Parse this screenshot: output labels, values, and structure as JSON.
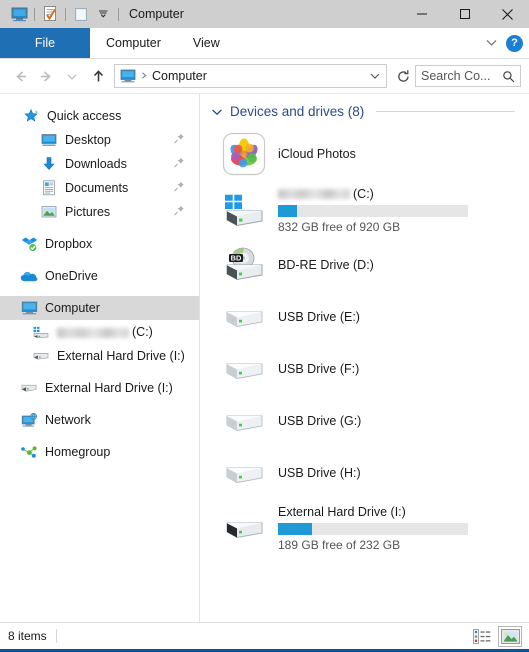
{
  "window": {
    "title": "Computer",
    "quick_access_toolbar": [
      {
        "name": "properties-computer-icon",
        "label": "Computer properties"
      },
      {
        "name": "properties-icon",
        "label": "Properties"
      },
      {
        "name": "new-folder-icon",
        "label": "New folder"
      },
      {
        "name": "customize-qat-icon",
        "label": "Customize Quick Access Toolbar"
      }
    ],
    "controls": {
      "minimize": "Minimize",
      "maximize": "Maximize",
      "close": "Close"
    }
  },
  "ribbon": {
    "tabs": [
      {
        "label": "File",
        "selected": true
      },
      {
        "label": "Computer",
        "selected": false
      },
      {
        "label": "View",
        "selected": false
      }
    ],
    "collapse_label": "Minimize the Ribbon",
    "help_label": "?"
  },
  "navigation": {
    "back": "Back",
    "forward": "Forward",
    "recent": "Recent locations",
    "up": "Up",
    "address": {
      "icon": "computer-icon",
      "crumb": "Computer",
      "dropdown": "Previous locations",
      "refresh": "Refresh"
    },
    "search": {
      "placeholder": "Search Co...",
      "value": "Search Co..."
    }
  },
  "sidebar": {
    "items": [
      {
        "label": "Quick access",
        "icon": "star-icon",
        "indent": 1,
        "pinned": false,
        "selected": false
      },
      {
        "label": "Desktop",
        "icon": "desktop-icon",
        "indent": 2,
        "pinned": true,
        "selected": false
      },
      {
        "label": "Downloads",
        "icon": "downloads-icon",
        "indent": 2,
        "pinned": true,
        "selected": false
      },
      {
        "label": "Documents",
        "icon": "documents-icon",
        "indent": 2,
        "pinned": true,
        "selected": false
      },
      {
        "label": "Pictures",
        "icon": "pictures-icon",
        "indent": 2,
        "pinned": true,
        "selected": false
      },
      {
        "label": "Dropbox",
        "icon": "dropbox-icon",
        "indent": 1,
        "pinned": false,
        "selected": false
      },
      {
        "label": "OneDrive",
        "icon": "onedrive-icon",
        "indent": 1,
        "pinned": false,
        "selected": false
      },
      {
        "label": "Computer",
        "icon": "computer-icon",
        "indent": 1,
        "pinned": false,
        "selected": true
      },
      {
        "label": "(C:)",
        "icon": "windows-drive-icon",
        "indent": 2,
        "pinned": false,
        "selected": false,
        "redacted": true
      },
      {
        "label": "External Hard Drive (I:)",
        "icon": "hard-drive-icon",
        "indent": 2,
        "pinned": false,
        "selected": false
      },
      {
        "label": "External Hard Drive (I:)",
        "icon": "hard-drive-icon",
        "indent": 1,
        "pinned": false,
        "selected": false
      },
      {
        "label": "Network",
        "icon": "network-icon",
        "indent": 1,
        "pinned": false,
        "selected": false
      },
      {
        "label": "Homegroup",
        "icon": "homegroup-icon",
        "indent": 1,
        "pinned": false,
        "selected": false
      }
    ]
  },
  "main": {
    "group": {
      "title": "Devices and drives (8)",
      "expanded": true
    },
    "drives": [
      {
        "name": "iCloud Photos",
        "icon": "icloud-photos-icon",
        "has_bar": false
      },
      {
        "name": "(C:)",
        "icon": "windows-drive-icon",
        "redacted": true,
        "has_bar": true,
        "used_percent": 10,
        "capacity_text": "832 GB free of 920 GB"
      },
      {
        "name": "BD-RE Drive (D:)",
        "icon": "bd-drive-icon",
        "has_bar": false
      },
      {
        "name": "USB Drive (E:)",
        "icon": "usb-drive-icon",
        "has_bar": false
      },
      {
        "name": "USB Drive (F:)",
        "icon": "usb-drive-icon",
        "has_bar": false
      },
      {
        "name": "USB Drive (G:)",
        "icon": "usb-drive-icon",
        "has_bar": false
      },
      {
        "name": "USB Drive (H:)",
        "icon": "usb-drive-icon",
        "has_bar": false
      },
      {
        "name": "External Hard Drive (I:)",
        "icon": "external-hard-drive-icon",
        "has_bar": true,
        "used_percent": 18,
        "capacity_text": "189 GB free of 232 GB"
      }
    ]
  },
  "status": {
    "item_count": "8 items",
    "views": [
      {
        "name": "details-view-button",
        "label": "Details view",
        "selected": false
      },
      {
        "name": "large-icons-view-button",
        "label": "Large icons view",
        "selected": true
      }
    ]
  },
  "colors": {
    "accent_blue": "#1e9ad6",
    "tab_blue": "#1f6fb5",
    "group_header": "#2a4b8d",
    "titlebar": "#cfcfcf",
    "selection": "#d8d8d8",
    "window_border": "#0b5394"
  }
}
